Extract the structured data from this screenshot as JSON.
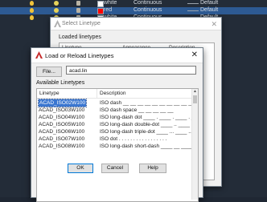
{
  "layers": [
    {
      "color_name": "white",
      "linetype": "Continuous",
      "lineweight": "Default",
      "swatch": "#ffffff",
      "highlight": false
    },
    {
      "color_name": "red",
      "linetype": "Continuous",
      "lineweight": "Default",
      "swatch": "#ff0000",
      "highlight": true
    },
    {
      "color_name": "white",
      "linetype": "Continuous",
      "lineweight": "Default",
      "swatch": "#ffffff",
      "highlight": false
    }
  ],
  "select_linetype": {
    "title": "Select Linetype",
    "loaded_label": "Loaded linetypes",
    "headers": {
      "linetype": "Linetype",
      "appearance": "Appearance",
      "description": "Description"
    }
  },
  "load_dialog": {
    "title": "Load or Reload Linetypes",
    "file_button": "File...",
    "file_value": "acad.lin",
    "available_label": "Available Linetypes",
    "col_linetype": "Linetype",
    "col_description": "Description",
    "rows": [
      {
        "name": "ACAD_ISO02W100",
        "desc": "ISO dash __ __ __ __ __ __ __ __ __ __ __",
        "selected": true
      },
      {
        "name": "ACAD_ISO03W100",
        "desc": "ISO dash space __    __    __    __    __",
        "selected": false
      },
      {
        "name": "ACAD_ISO04W100",
        "desc": "ISO long-dash dot ____ . ____ . ____ . __",
        "selected": false
      },
      {
        "name": "ACAD_ISO05W100",
        "desc": "ISO long-dash double-dot ____ .. ____ .. __",
        "selected": false
      },
      {
        "name": "ACAD_ISO06W100",
        "desc": "ISO long-dash triple-dot ____ ... ____ ...",
        "selected": false
      },
      {
        "name": "ACAD_ISO07W100",
        "desc": "ISO dot . . . . . . . . . . . . . . . . .",
        "selected": false
      },
      {
        "name": "ACAD_ISO08W100",
        "desc": "ISO long-dash short-dash ____ __ ____ __",
        "selected": false
      }
    ],
    "buttons": {
      "ok": "OK",
      "cancel": "Cancel",
      "help": "Help"
    }
  },
  "colors": {
    "accent": "#3a76d0",
    "autocad_red": "#c62828"
  }
}
